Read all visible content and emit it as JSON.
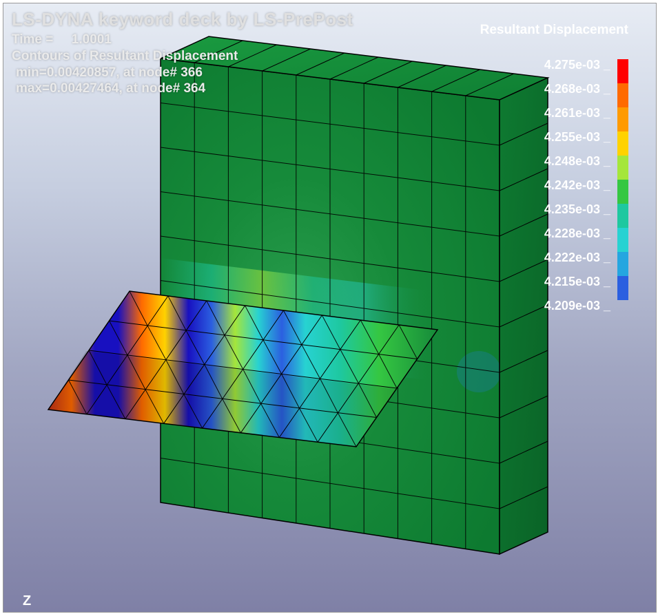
{
  "header": {
    "title": "LS-DYNA keyword deck by LS-PrePost",
    "time_label": "Time =",
    "time_value": "1.0001",
    "contour_label": "Contours of Resultant Displacement",
    "min_line": "min=0.00420857, at node# 366",
    "max_line": "max=0.00427464, at node# 364"
  },
  "legend": {
    "title": "Resultant Displacement",
    "entries": [
      {
        "value": "4.275e-03",
        "color": "#ff0000"
      },
      {
        "value": "4.268e-03",
        "color": "#ff6a00"
      },
      {
        "value": "4.261e-03",
        "color": "#ff9a00"
      },
      {
        "value": "4.255e-03",
        "color": "#ffd200"
      },
      {
        "value": "4.248e-03",
        "color": "#a5e63b"
      },
      {
        "value": "4.242e-03",
        "color": "#35c742"
      },
      {
        "value": "4.235e-03",
        "color": "#1ec8a0"
      },
      {
        "value": "4.228e-03",
        "color": "#27d2d2"
      },
      {
        "value": "4.222e-03",
        "color": "#25a6e0"
      },
      {
        "value": "4.215e-03",
        "color": "#2b5fe0"
      },
      {
        "value": "4.209e-03",
        "color": "#1810c0"
      }
    ]
  },
  "axis": {
    "z": "Z"
  },
  "chart_data": {
    "type": "heatmap",
    "title": "Contours of Resultant Displacement",
    "units": "displacement",
    "min": 0.00420857,
    "max": 0.00427464,
    "min_node": 366,
    "max_node": 364,
    "time": 1.0001,
    "colorscale": [
      [
        0.0,
        "#1810c0"
      ],
      [
        0.1,
        "#2b5fe0"
      ],
      [
        0.2,
        "#25a6e0"
      ],
      [
        0.3,
        "#27d2d2"
      ],
      [
        0.4,
        "#1ec8a0"
      ],
      [
        0.5,
        "#35c742"
      ],
      [
        0.6,
        "#a5e63b"
      ],
      [
        0.7,
        "#ffd200"
      ],
      [
        0.8,
        "#ff9a00"
      ],
      [
        0.9,
        "#ff6a00"
      ],
      [
        1.0,
        "#ff0000"
      ]
    ],
    "legend_ticks": [
      0.004209,
      0.004215,
      0.004222,
      0.004228,
      0.004235,
      0.004242,
      0.004248,
      0.004255,
      0.004261,
      0.004268,
      0.004275
    ],
    "geometry": {
      "block": {
        "nx": 10,
        "ny": 10,
        "nz": 1
      },
      "sheet": {
        "rows": 4,
        "cols": 8
      }
    }
  }
}
